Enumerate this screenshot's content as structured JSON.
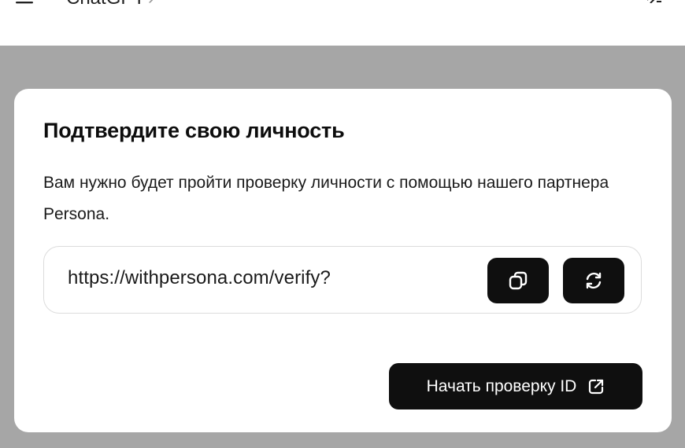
{
  "header": {
    "app_title": "ChatGPT",
    "app_title_chevron": "›",
    "menu_icon": "menu-icon",
    "right_icon": "edit-icon"
  },
  "dialog": {
    "title": "Подтвердите свою личность",
    "description": "Вам нужно будет пройти проверку личности с помощью нашего партнера Persona.",
    "verification_url": "https://withpersona.com/verify?",
    "copy_icon": "copy-icon",
    "refresh_icon": "refresh-icon",
    "start_button_label": "Начать проверку ID",
    "start_button_icon": "external-link-icon"
  },
  "colors": {
    "overlay": "#a6a6a6",
    "card": "#ffffff",
    "button": "#0f0f0f",
    "button_text": "#ffffff",
    "border": "#dcdcdc"
  }
}
